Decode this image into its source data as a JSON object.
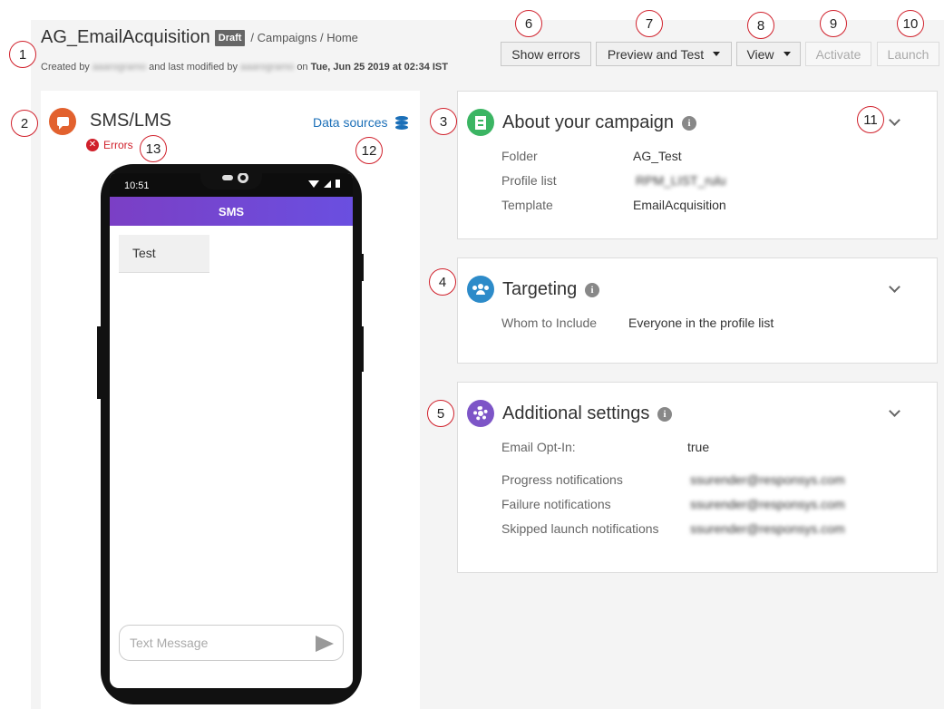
{
  "header": {
    "campaign_title": "AG_EmailAcquisition",
    "status_badge": "Draft",
    "breadcrumb": "/ Campaigns / Home",
    "created_by_prefix": "Created by",
    "created_by_user": "aaarogramo",
    "modified_by_text": "and last modified by",
    "modified_by_user": "aaarogramo",
    "modified_on_text": "on",
    "modified_date": "Tue, Jun 25 2019 at 02:34 IST"
  },
  "toolbar": {
    "show_errors": "Show errors",
    "preview_and_test": "Preview and Test",
    "view": "View",
    "activate": "Activate",
    "launch": "Launch"
  },
  "channel": {
    "title": "SMS/LMS",
    "errors_label": "Errors",
    "data_sources_label": "Data sources"
  },
  "phone": {
    "time": "10:51",
    "app_bar_title": "SMS",
    "message": "Test",
    "input_placeholder": "Text Message"
  },
  "about": {
    "title": "About your campaign",
    "rows": [
      {
        "label": "Folder",
        "value": "AG_Test"
      },
      {
        "label": "Profile list",
        "value": "RPM_LIST_rulu"
      },
      {
        "label": "Template",
        "value": "EmailAcquisition"
      }
    ]
  },
  "targeting": {
    "title": "Targeting",
    "rows": [
      {
        "label": "Whom to Include",
        "value": "Everyone in the profile list"
      }
    ]
  },
  "additional": {
    "title": "Additional settings",
    "rows": [
      {
        "label": "Email Opt-In:",
        "value": "true"
      },
      {
        "label": "Progress notifications",
        "value": "ssurender@responsys.com"
      },
      {
        "label": "Failure notifications",
        "value": "ssurender@responsys.com"
      },
      {
        "label": "Skipped launch notifications",
        "value": "ssurender@responsys.com"
      }
    ]
  },
  "annotations": [
    "1",
    "2",
    "3",
    "4",
    "5",
    "6",
    "7",
    "8",
    "9",
    "10",
    "11",
    "12",
    "13"
  ],
  "colors": {
    "sms_icon": "#e2612e",
    "error_red": "#d0202b",
    "link_blue": "#1b6fb8",
    "about_icon": "#3bb563",
    "targeting_icon": "#2d8bc9",
    "settings_icon": "#7d55c7",
    "sms_bar": "#6a4fe0"
  },
  "icons": {
    "channel": "chat-bubble-icon",
    "errors": "error-x-icon",
    "data_sources": "database-icon",
    "about": "document-icon",
    "targeting": "people-icon",
    "additional": "gear-icon",
    "info": "info-icon",
    "expand": "chevron-down-icon",
    "send": "send-icon"
  }
}
